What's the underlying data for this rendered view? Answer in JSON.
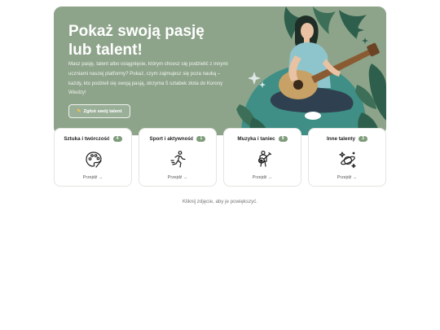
{
  "hero": {
    "title": "Pokaż swoją pasję lub talent!",
    "description": "Masz pasję, talent albo osiągnięcie, którym chcesz się podzielić z innymi uczniami naszej platformy? Pokaż, czym zajmujesz się poza nauką – każdy, kto podzieli się swoją pasją, otrzyma 5 sztabek złota do Korony Wiedzy!",
    "button_label": "Zgłoś swój talent",
    "button_icon": "pencil-icon"
  },
  "categories": [
    {
      "title": "Sztuka i twórczość",
      "count": "4",
      "link": "Przejdź →",
      "icon": "palette-icon"
    },
    {
      "title": "Sport i aktywność",
      "count": "1",
      "link": "Przejdź →",
      "icon": "running-icon"
    },
    {
      "title": "Muzyka i taniec",
      "count": "9",
      "link": "Przejdź →",
      "icon": "guitarist-icon"
    },
    {
      "title": "Inne talenty",
      "count": "3",
      "link": "Przejdź →",
      "icon": "planet-sparkles-icon"
    }
  ],
  "caption": "Kliknij zdjęcie, aby je powiększyć.",
  "colors": {
    "accent": "#7e9c7a",
    "hero_bg": "#8da48a",
    "leaf_dark": "#2e5f4c",
    "leaf_teal": "#3f8f86"
  }
}
